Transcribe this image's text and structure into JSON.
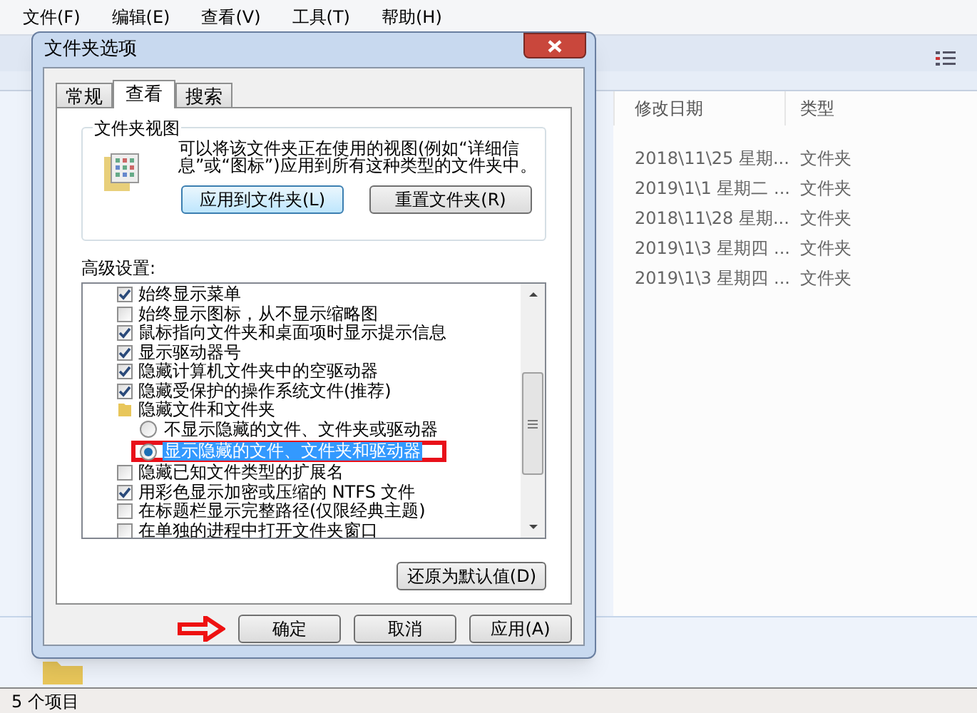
{
  "menu_bar": [
    "文件(F)",
    "编辑(E)",
    "查看(V)",
    "工具(T)",
    "帮助(H)"
  ],
  "file_list": {
    "columns": [
      "修改日期",
      "类型"
    ],
    "rows": [
      {
        "modified": "2018\\11\\25 星期...",
        "type": "文件夹"
      },
      {
        "modified": "2019\\1\\1 星期二 ...",
        "type": "文件夹"
      },
      {
        "modified": "2018\\11\\28 星期...",
        "type": "文件夹"
      },
      {
        "modified": "2019\\1\\3 星期四 ...",
        "type": "文件夹"
      },
      {
        "modified": "2019\\1\\3 星期四 ...",
        "type": "文件夹"
      }
    ]
  },
  "status_bar": "5 个项目",
  "dialog": {
    "title": "文件夹选项",
    "tabs": [
      {
        "label": "常规",
        "selected": false
      },
      {
        "label": "查看",
        "selected": true
      },
      {
        "label": "搜索",
        "selected": false
      }
    ],
    "folder_view": {
      "title": "文件夹视图",
      "description": "可以将该文件夹正在使用的视图(例如“详细信息”或“图标”)应用到所有这种类型的文件夹中。",
      "buttons": [
        "应用到文件夹(L)",
        "重置文件夹(R)"
      ]
    },
    "advanced": {
      "label": "高级设置:",
      "items": [
        {
          "kind": "checkbox",
          "label": "始终显示菜单",
          "checked": true
        },
        {
          "kind": "checkbox",
          "label": "始终显示图标，从不显示缩略图",
          "checked": false
        },
        {
          "kind": "checkbox",
          "label": "鼠标指向文件夹和桌面项时显示提示信息",
          "checked": true
        },
        {
          "kind": "checkbox",
          "label": "显示驱动器号",
          "checked": true
        },
        {
          "kind": "checkbox",
          "label": "隐藏计算机文件夹中的空驱动器",
          "checked": true
        },
        {
          "kind": "checkbox",
          "label": "隐藏受保护的操作系统文件(推荐)",
          "checked": true
        },
        {
          "kind": "folder",
          "label": "隐藏文件和文件夹",
          "children": [
            {
              "kind": "radio",
              "label": "不显示隐藏的文件、文件夹或驱动器",
              "selected": false
            },
            {
              "kind": "radio",
              "label": "显示隐藏的文件、文件夹和驱动器",
              "selected": true
            }
          ]
        },
        {
          "kind": "checkbox",
          "label": "隐藏已知文件类型的扩展名",
          "checked": false
        },
        {
          "kind": "checkbox",
          "label": "用彩色显示加密或压缩的 NTFS 文件",
          "checked": true
        },
        {
          "kind": "checkbox",
          "label": "在标题栏显示完整路径(仅限经典主题)",
          "checked": false
        },
        {
          "kind": "checkbox",
          "label": "在单独的进程中打开文件夹窗口",
          "checked": false
        }
      ]
    },
    "restore_button": "还原为默认值(D)",
    "buttons": [
      "确定",
      "取消",
      "应用(A)"
    ]
  }
}
